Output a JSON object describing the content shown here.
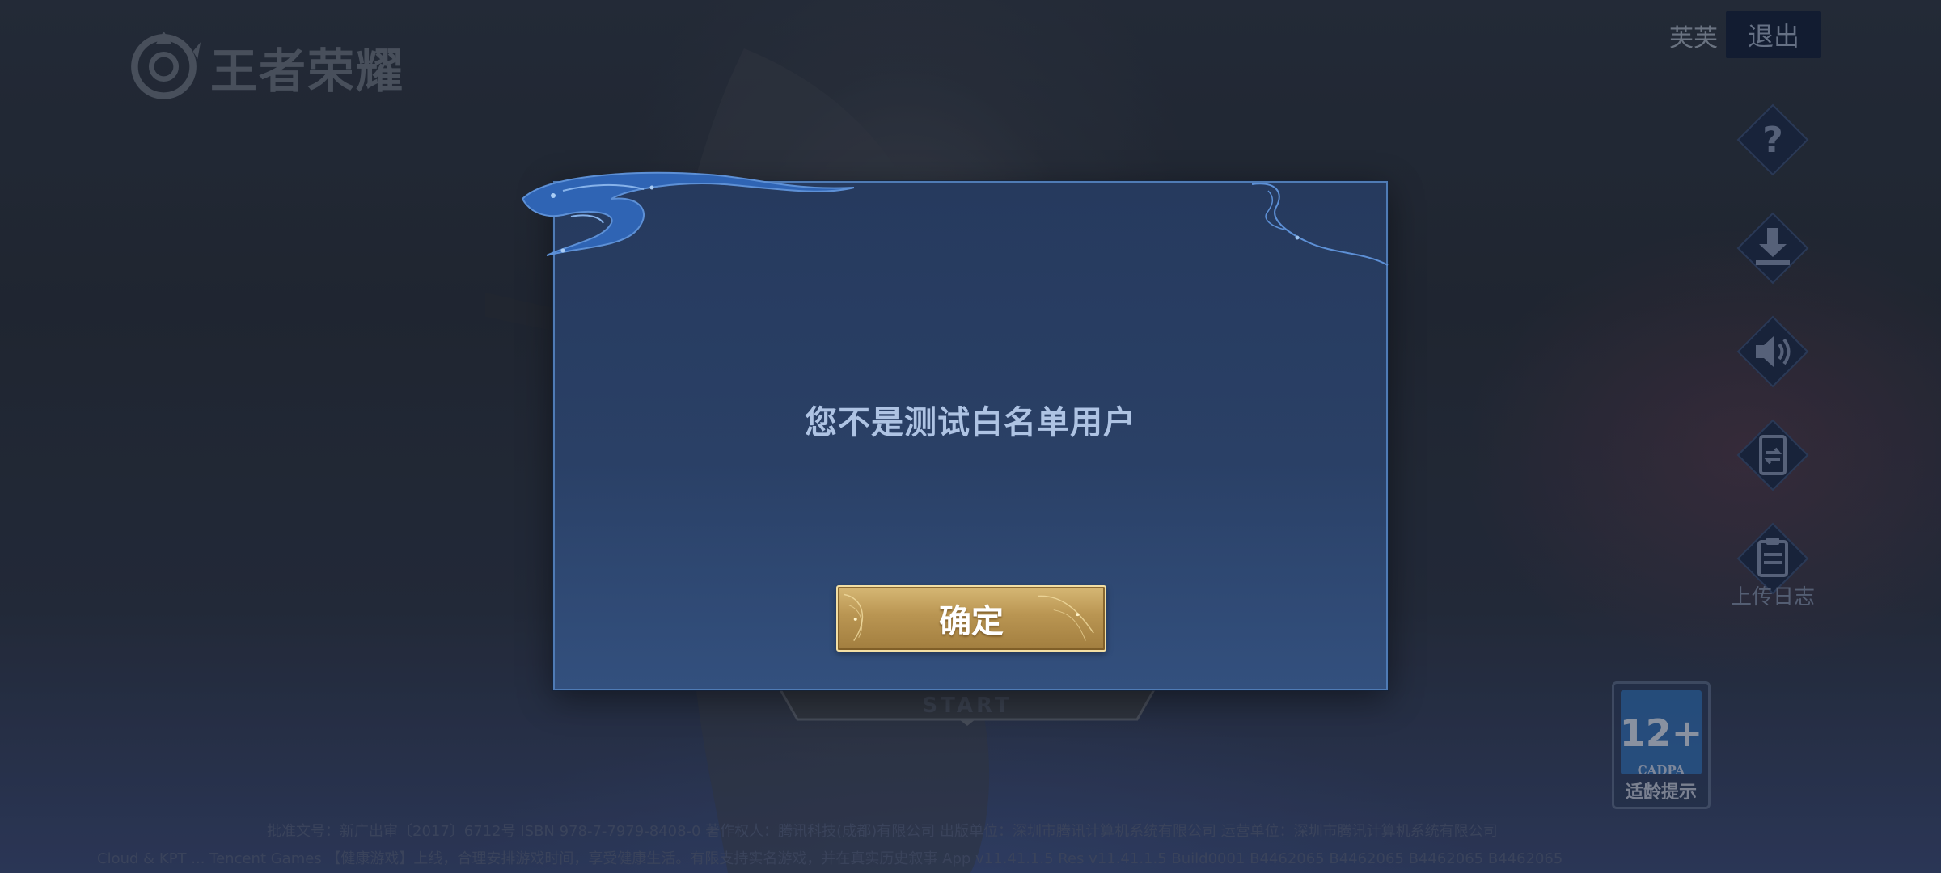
{
  "app": {
    "logo_text": "王者荣耀"
  },
  "header": {
    "username": "芙芙",
    "logout_label": "退出"
  },
  "side_buttons": {
    "help_icon": "question-diamond-icon",
    "download_icon": "download-diamond-icon",
    "sound_icon": "speaker-diamond-icon",
    "switch_icon": "switch-account-diamond-icon",
    "upload_log_icon": "clipboard-diamond-icon",
    "upload_log_label": "上传日志"
  },
  "age_badge": {
    "rating": "12+",
    "org": "CADPA",
    "hint": "适龄提示"
  },
  "start_button": {
    "label": "START"
  },
  "dialog": {
    "message": "您不是测试白名单用户",
    "confirm_label": "确定"
  },
  "footer": {
    "line1": "批准文号：新广出审〔2017〕6712号  ISBN 978-7-7979-8408-0  著作权人：腾讯科技(成都)有限公司  出版单位：深圳市腾讯计算机系统有限公司  运营单位：深圳市腾讯计算机系统有限公司",
    "line2": "Cloud & KPT ...  Tencent Games  【健康游戏】上线，合理安排游戏时间，享受健康生活。有限支持实名游戏，并在真实历史叙事 App v11.41.1.5 Res v11.41.1.5 Build0001 B4462065 B4462065 B4462065 B4462065"
  },
  "colors": {
    "dialog_bg": "#263a5e",
    "dialog_border": "#4f7bb5",
    "message_text": "#aec3e3",
    "confirm_gold": "#b99552",
    "badge_blue": "#2f6fb4"
  }
}
